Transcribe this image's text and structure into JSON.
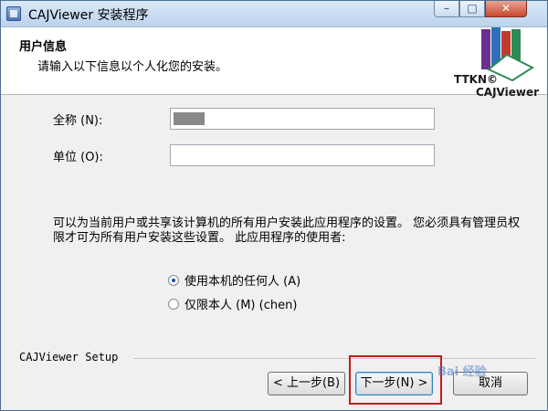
{
  "window": {
    "title": "CAJViewer 安装程序",
    "controls": {
      "minimize": "–",
      "maximize": "□",
      "close": "✕"
    }
  },
  "header": {
    "title": "用户信息",
    "subtitle": "请输入以下信息以个人化您的安装。",
    "logo": {
      "line1": "TTKN©",
      "line2": "CAJViewer"
    }
  },
  "form": {
    "full_name_label": "全称 (N):",
    "full_name_value": "",
    "organization_label": "单位 (O):",
    "organization_value": ""
  },
  "description": "可以为当前用户或共享该计算机的所有用户安装此应用程序的设置。 您必须具有管理员权限才可为所有用户安装这些设置。 此应用程序的使用者:",
  "install_options": [
    {
      "label": "使用本机的任何人 (A)",
      "checked": true
    },
    {
      "label": "仅限本人 (M) (chen)",
      "checked": false
    }
  ],
  "footer": {
    "label": "CAJViewer Setup"
  },
  "buttons": {
    "back": "< 上一步(B)",
    "next": "下一步(N) >",
    "cancel": "取消"
  },
  "watermark": "Bai 经验",
  "colors": {
    "highlight_border": "#c61b1b",
    "title_bar": "#bcd3ec"
  }
}
